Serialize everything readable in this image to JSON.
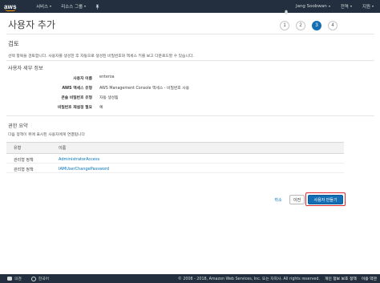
{
  "nav": {
    "logo": "aws",
    "services": "서비스",
    "resource_groups": "리소스 그룹",
    "user": "Jang Soobwan",
    "region": "전역",
    "support": "지원"
  },
  "header": {
    "title": "사용자 추가",
    "steps": [
      "1",
      "2",
      "3",
      "4"
    ],
    "active_step": 3
  },
  "review": {
    "heading": "검토",
    "description": "선택 항목을 검토합니다. 사용자를 생성한 후 자동으로 생성된 비밀번호와 액세스 키를 보고 다운로드할 수 있습니다."
  },
  "details": {
    "heading": "사용자 세부 정보",
    "rows": [
      {
        "key": "사용자 이름",
        "value": "enteroa"
      },
      {
        "key": "AWS 액세스 유형",
        "value": "AWS Management Console 액세스 - 비밀번호 사용"
      },
      {
        "key": "콘솔 비밀번호 유형",
        "value": "자동 생성됨"
      },
      {
        "key": "비밀번호 재설정 필요",
        "value": "예"
      }
    ]
  },
  "permissions": {
    "heading": "권한 요약",
    "description": "다음 정책이 위에 표시된 사용자에게 연결됩니다",
    "columns": [
      "유형",
      "이름"
    ],
    "rows": [
      {
        "type": "관리형 정책",
        "name": "AdministratorAccess"
      },
      {
        "type": "관리형 정책",
        "name": "IAMUserChangePassword"
      }
    ]
  },
  "actions": {
    "cancel": "취소",
    "previous": "이전",
    "create": "사용자 만들기"
  },
  "footer": {
    "feedback": "의견",
    "language": "한국어",
    "copyright": "© 2008 - 2018, Amazon Web Services, Inc. 또는 자회사. All rights reserved.",
    "privacy": "개인 정보 보호 정책",
    "terms": "이용 약관"
  },
  "colors": {
    "nav_bg": "#232f3e",
    "accent": "#146eb4",
    "highlight": "#e0262e",
    "link": "#0073bb"
  }
}
